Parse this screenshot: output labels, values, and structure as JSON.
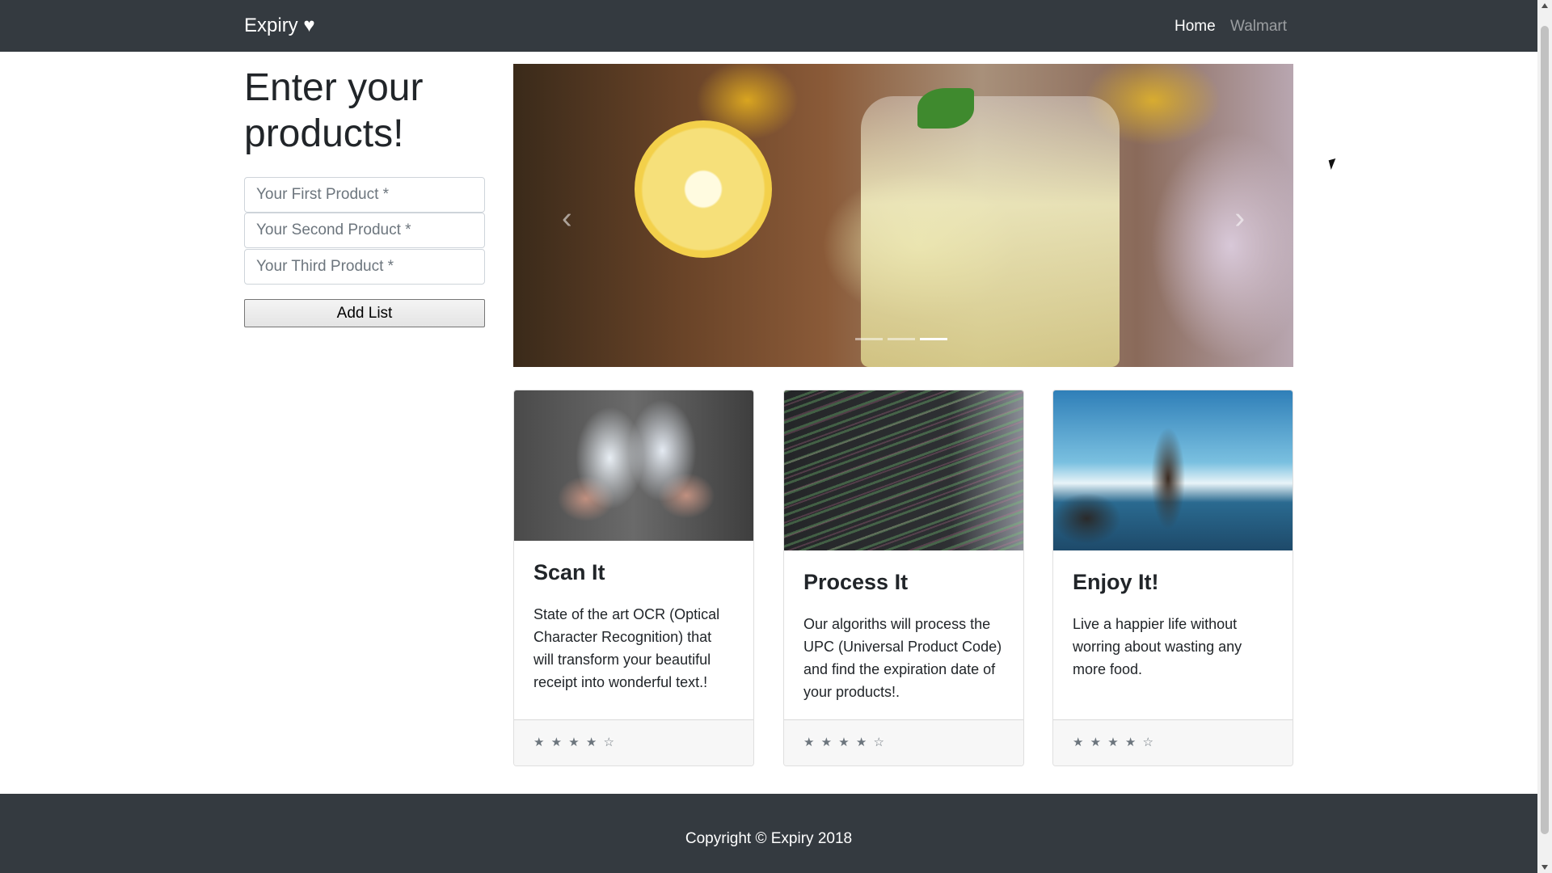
{
  "navbar": {
    "brand": "Expiry ♥",
    "links": [
      {
        "label": "Home",
        "active": true
      },
      {
        "label": "Walmart",
        "active": false
      }
    ]
  },
  "form": {
    "heading": "Enter your products!",
    "fields": [
      {
        "placeholder": "Your First Product *",
        "value": ""
      },
      {
        "placeholder": "Your Second Product *",
        "value": ""
      },
      {
        "placeholder": "Your Third Product *",
        "value": ""
      }
    ],
    "submit_label": "Add List"
  },
  "carousel": {
    "prev_icon": "‹",
    "next_icon": "›",
    "slide_count": 3,
    "active_slide": 3
  },
  "cards": [
    {
      "title": "Scan It",
      "text": "State of the art OCR (Optical Character Recognition) that will transform your beautiful receipt into wonderful text.!",
      "rating": "★ ★ ★ ★ ☆",
      "rating_value": 4
    },
    {
      "title": "Process It",
      "text": "Our algoriths will process the UPC (Universal Product Code) and find the expiration date of your products!.",
      "rating": "★ ★ ★ ★ ☆",
      "rating_value": 4
    },
    {
      "title": "Enjoy It!",
      "text": "Live a happier life without worring about wasting any more food.",
      "rating": "★ ★ ★ ★ ☆",
      "rating_value": 4
    }
  ],
  "footer": {
    "copyright": "Copyright © Expiry 2018"
  },
  "colors": {
    "navbar_bg": "#343a40",
    "footer_bg": "#343a40",
    "link_active": "#ffffff",
    "link_inactive": "rgba(255,255,255,0.5)"
  }
}
